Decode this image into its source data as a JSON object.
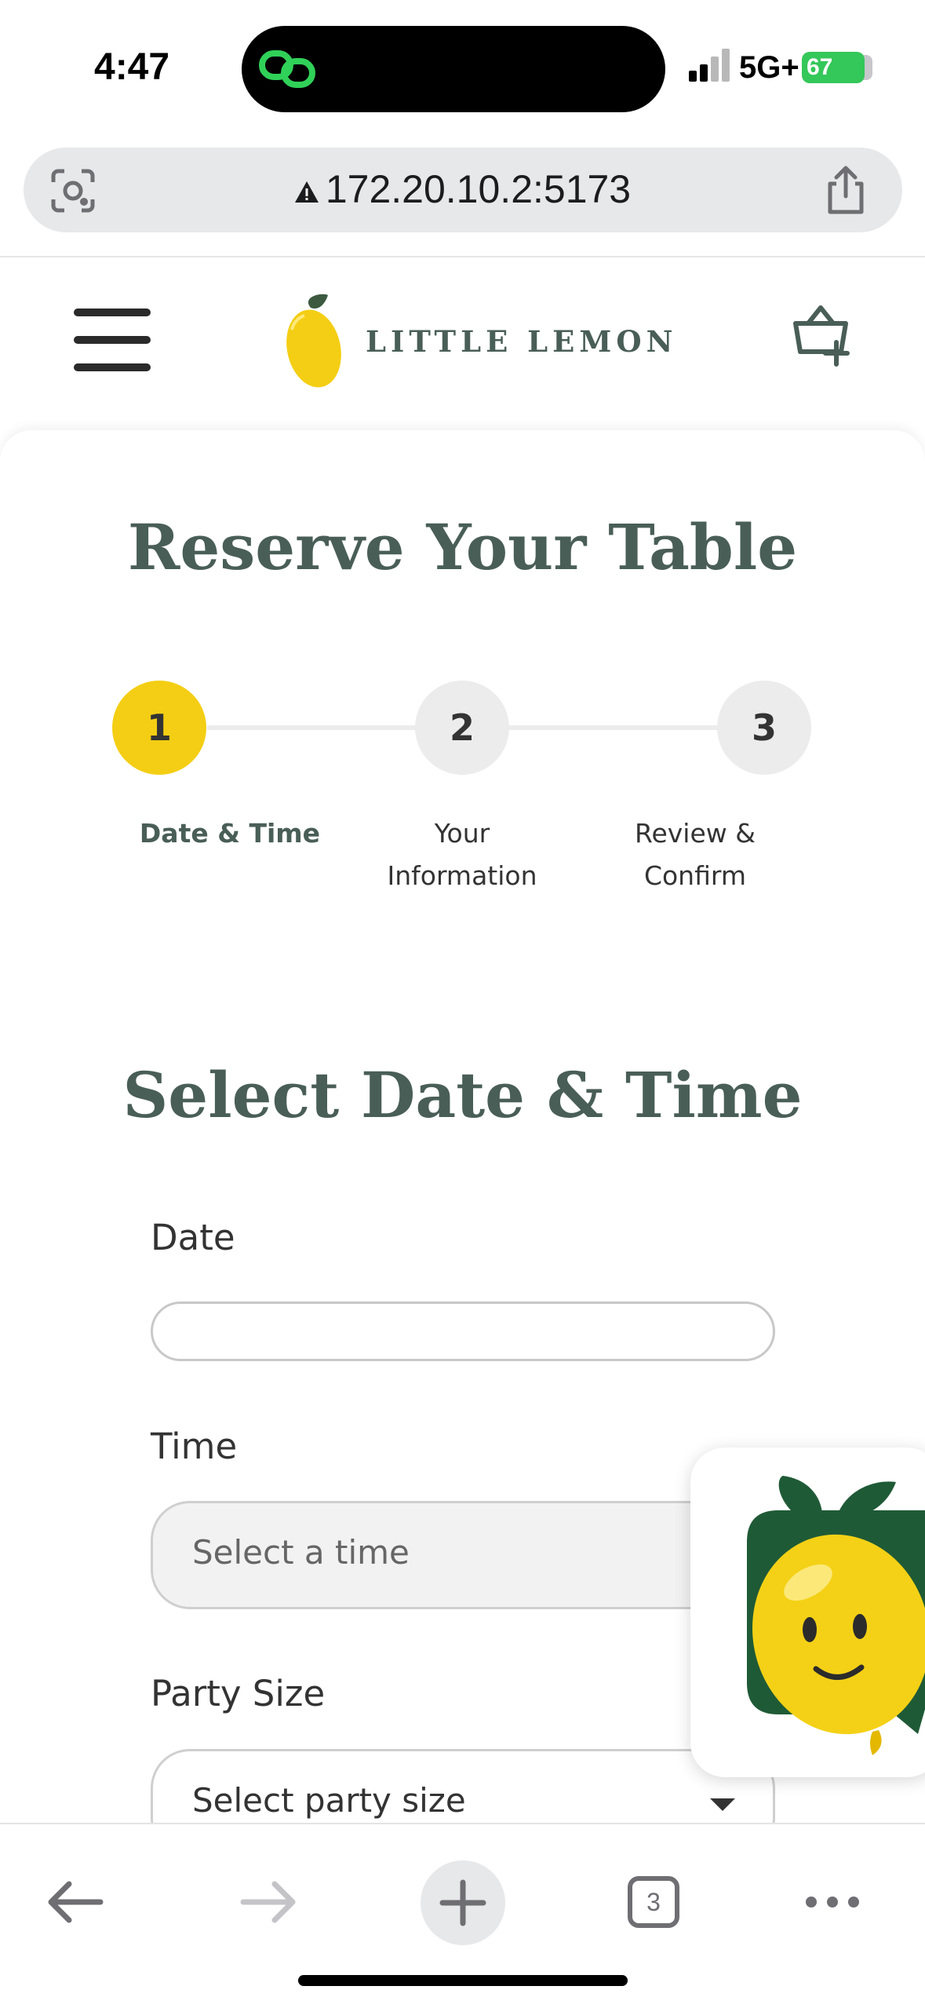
{
  "status_bar": {
    "time": "4:47",
    "network": "5G+",
    "battery": "67"
  },
  "browser": {
    "url": "172.20.10.2:5173",
    "tab_count": "3"
  },
  "site": {
    "brand": "LITTLE LEMON"
  },
  "page": {
    "title": "Reserve Your Table",
    "steps": [
      {
        "number": "1",
        "label": "Date & Time"
      },
      {
        "number": "2",
        "label_line1": "Your",
        "label_line2": "Information"
      },
      {
        "number": "3",
        "label_line1": "Review &",
        "label_line2": "Confirm"
      }
    ],
    "section_title": "Select Date & Time",
    "form": {
      "date_label": "Date",
      "date_value": "",
      "time_label": "Time",
      "time_placeholder": "Select a time",
      "party_label": "Party Size",
      "party_placeholder": "Select party size"
    }
  },
  "colors": {
    "primary_green": "#495e57",
    "accent_yellow": "#f4ce14"
  },
  "icons": [
    "lens-icon",
    "warning-icon",
    "share-icon",
    "hamburger-menu-icon",
    "lemon-logo-icon",
    "cart-add-icon",
    "back-arrow-icon",
    "forward-arrow-icon",
    "new-tab-icon",
    "tabs-icon",
    "more-icon"
  ]
}
